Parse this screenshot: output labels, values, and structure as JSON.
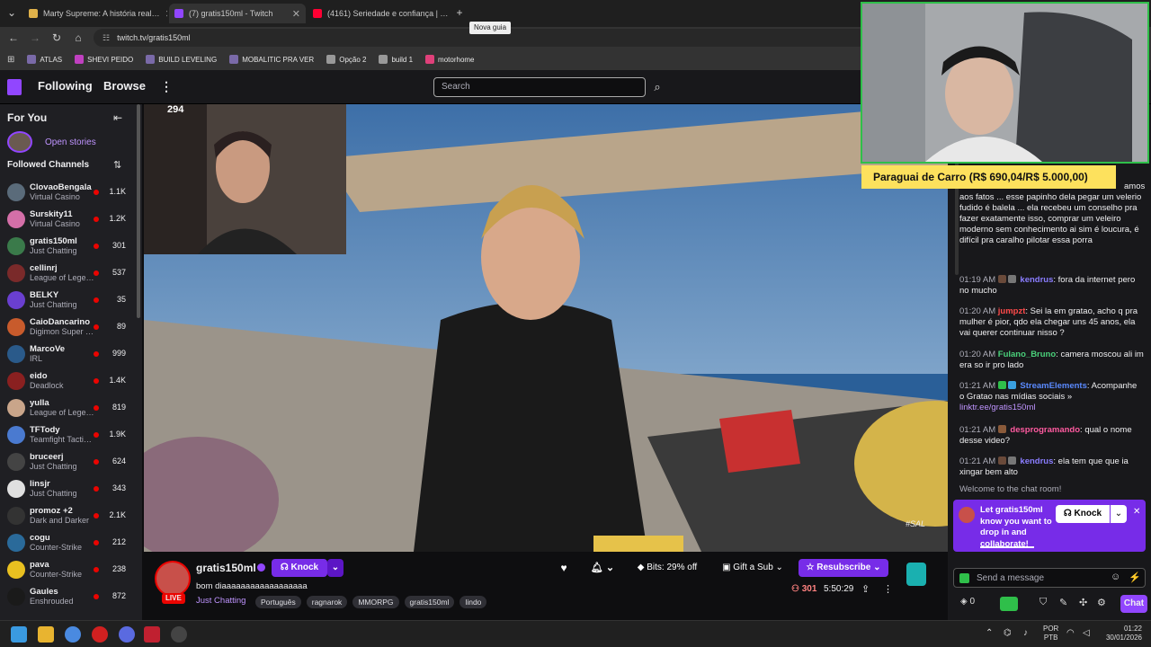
{
  "browser": {
    "tabs": [
      {
        "title": "Marty Supreme: A história real…",
        "color": "#e0b24a"
      },
      {
        "title": "(7) gratis150ml - Twitch",
        "color": "#9146ff"
      },
      {
        "title": "(4161) Seriedade e confiança | …",
        "color": "#ff0033"
      }
    ],
    "new_tab_tooltip": "Nova guia",
    "url": "twitch.tv/gratis150ml",
    "bookmarks": [
      "ATLAS",
      "SHEVI PEIDO",
      "BUILD LEVELING",
      "MOBALITIC PRA VER",
      "Opção 2",
      "build 1",
      "motorhome"
    ]
  },
  "nav": {
    "following": "Following",
    "browse": "Browse",
    "search_placeholder": "Search"
  },
  "sidebar": {
    "for_you": "For You",
    "open_stories": "Open stories",
    "followed_channels": "Followed Channels",
    "channels": [
      {
        "name": "ClovaoBengala",
        "game": "Virtual Casino",
        "viewers": "1.1K",
        "color": "#5a6b7a"
      },
      {
        "name": "Surskity11",
        "game": "Virtual Casino",
        "viewers": "1.2K",
        "color": "#d46fa8"
      },
      {
        "name": "gratis150ml",
        "game": "Just Chatting",
        "viewers": "301",
        "color": "#3a7a4a"
      },
      {
        "name": "cellinrj",
        "game": "League of Lege…",
        "viewers": "537",
        "color": "#7a2a2a"
      },
      {
        "name": "BELKY",
        "game": "Just Chatting",
        "viewers": "35",
        "color": "#6a3fd0"
      },
      {
        "name": "CaioDancarino",
        "game": "Digimon Super …",
        "viewers": "89",
        "color": "#c85b2c"
      },
      {
        "name": "MarcoVe",
        "game": "IRL",
        "viewers": "999",
        "color": "#2a5a8a"
      },
      {
        "name": "eido",
        "game": "Deadlock",
        "viewers": "1.4K",
        "color": "#8a2020"
      },
      {
        "name": "yulla",
        "game": "League of Lege…",
        "viewers": "819",
        "color": "#c9a58a"
      },
      {
        "name": "TFTody",
        "game": "Teamfight Tacti…",
        "viewers": "1.9K",
        "color": "#4a7ad0"
      },
      {
        "name": "bruceerj",
        "game": "Just Chatting",
        "viewers": "624",
        "color": "#444"
      },
      {
        "name": "linsjr",
        "game": "Just Chatting",
        "viewers": "343",
        "color": "#e0e0e0"
      },
      {
        "name": "promoz +2",
        "game": "Dark and Darker",
        "viewers": "2.1K",
        "color": "#333"
      },
      {
        "name": "cogu",
        "game": "Counter-Strike",
        "viewers": "212",
        "color": "#2a6a9a"
      },
      {
        "name": "pava",
        "game": "Counter-Strike",
        "viewers": "238",
        "color": "#e8c020"
      },
      {
        "name": "Gaules",
        "game": "Enshrouded",
        "viewers": "872",
        "color": "#1a1a1a"
      }
    ]
  },
  "overlay": {
    "viewer_count_overlay": "294",
    "goal_text": "Paraguai de Carro (R$ 690,04/R$ 5.000,00)"
  },
  "channel": {
    "name": "gratis150ml",
    "title": "bom diaaaaaaaaaaaaaaaaaa",
    "live": "LIVE",
    "category": "Just Chatting",
    "tags": [
      "Português",
      "ragnarok",
      "MMORPG",
      "gratis150ml",
      "lindo"
    ],
    "knock": "Knock",
    "bits": "Bits: 29% off",
    "gift": "Gift a Sub",
    "resubscribe": "Resubscribe",
    "viewers": "301",
    "uptime": "5:50:29"
  },
  "chat": {
    "first_msg_tail": "amos",
    "messages": [
      {
        "time": "",
        "user": "",
        "text": "aos fatos ... esse papinho dela pegar um velerio fudido é balela ... ela recebeu um conselho pra fazer exatamente isso, comprar um veleiro moderno sem conhecimento ai sim é loucura, é difícil pra caralho pilotar essa porra",
        "color": "#efeff1"
      },
      {
        "time": "01:19 AM",
        "user": "kendrus",
        "text": "fora da internet pero no mucho",
        "color": "#8a7dff"
      },
      {
        "time": "01:20 AM",
        "user": "jumpzt",
        "text": "Sei la em gratao, acho q pra mulher é pior, qdo ela chegar uns 45 anos, ela vai querer continuar nisso ?",
        "color": "#ff4a4a"
      },
      {
        "time": "01:20 AM",
        "user": "Fulano_Bruno",
        "text": "camera moscou ali im era so ir pro lado",
        "color": "#4ad07a"
      },
      {
        "time": "01:21 AM",
        "user": "StreamElements",
        "text": "Acompanhe o Gratao nas mídias sociais » ",
        "link": "linktr.ee/gratis150ml",
        "color": "#5a8aff"
      },
      {
        "time": "01:21 AM",
        "user": "desprogramando",
        "text": "qual o nome desse video?",
        "color": "#ff5aa0"
      },
      {
        "time": "01:21 AM",
        "user": "kendrus",
        "text": "ela tem que que ia xingar bem alto",
        "color": "#8a7dff"
      }
    ],
    "welcome": "Welcome to the chat room!",
    "collab_text": "Let gratis150ml know you want to drop in and collaborate!",
    "collab_knock": "Knock",
    "send_placeholder": "Send a message",
    "points": "0",
    "chat_button": "Chat"
  },
  "taskbar": {
    "lang": "POR",
    "lang2": "PTB",
    "time": "01:22",
    "date": "30/01/2026"
  }
}
